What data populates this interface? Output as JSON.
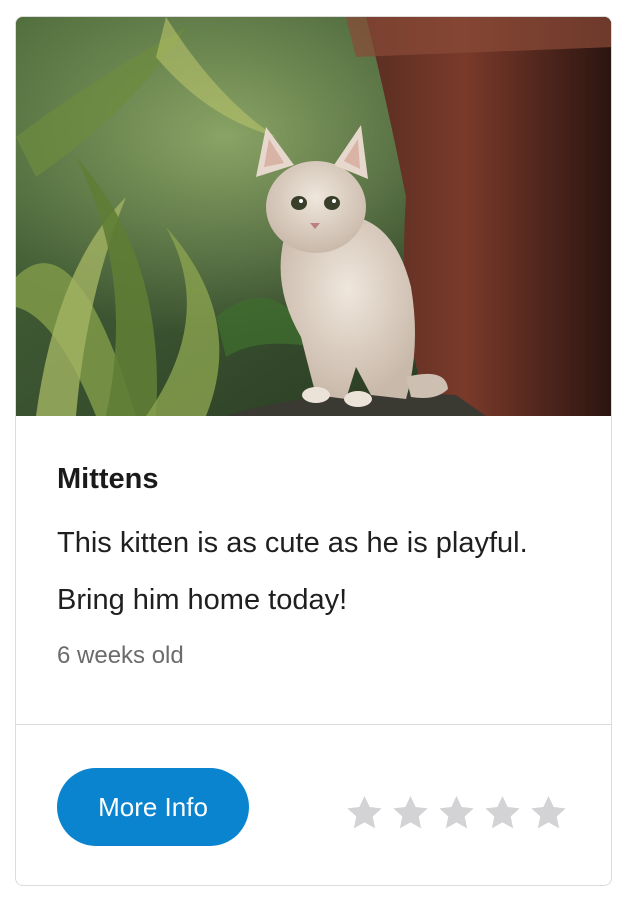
{
  "card": {
    "image_alt": "Kitten sitting beside a flower pot",
    "title": "Mittens",
    "description": "This kitten is as cute as he is playful. Bring him home today!",
    "age": "6 weeks old",
    "button_label": "More Info",
    "rating": {
      "value": 0,
      "max": 5
    },
    "colors": {
      "button": "#0a84ce",
      "star_empty": "#d3d3d6",
      "border": "#dcdcdc"
    }
  }
}
